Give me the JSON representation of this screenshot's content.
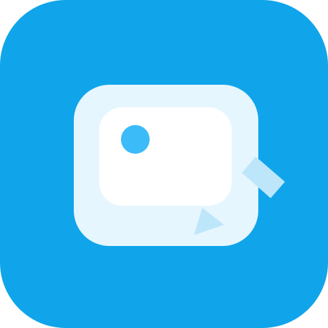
{
  "icon": {
    "name": "video-app-icon",
    "colors": {
      "background": "#10A5EA",
      "frame": "#E6F6FE",
      "screen": "#FFFFFF",
      "dot": "#3BBBF8",
      "accent": "#BEE6FB"
    }
  }
}
